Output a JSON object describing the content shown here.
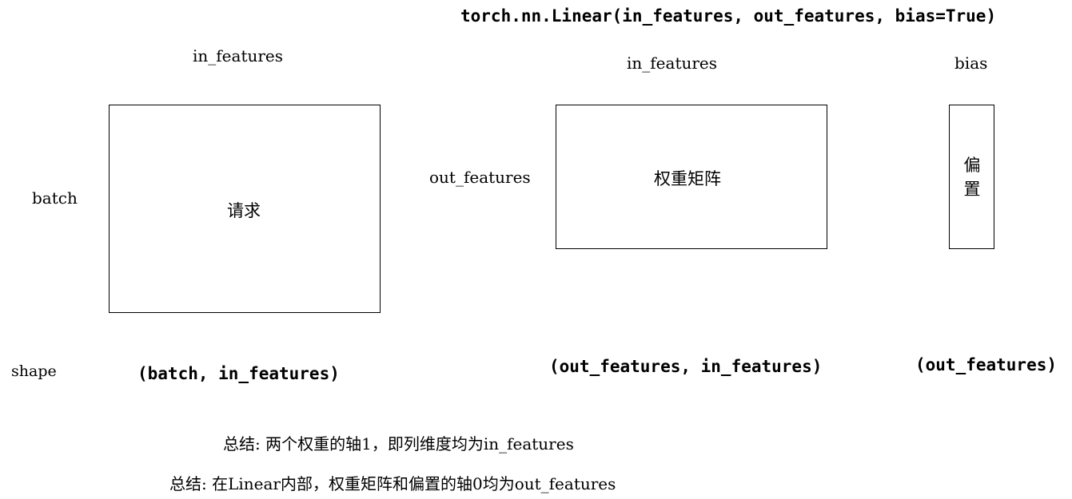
{
  "signature": "torch.nn.Linear(in_features, out_features, bias=True)",
  "input_block": {
    "top_label": "in_features",
    "side_label": "batch",
    "inner_label": "请求",
    "shape": "(batch, in_features)"
  },
  "weight_block": {
    "top_label": "in_features",
    "side_label": "out_features",
    "inner_label": "权重矩阵",
    "shape": "(out_features, in_features)"
  },
  "bias_block": {
    "top_label": "bias",
    "inner_label": "偏置",
    "shape": "(out_features)"
  },
  "shape_row_label": "shape",
  "summary": {
    "line1": "总结: 两个权重的轴1，即列维度均为in_features",
    "line2": "总结: 在Linear内部，权重矩阵和偏置的轴0均为out_features"
  }
}
